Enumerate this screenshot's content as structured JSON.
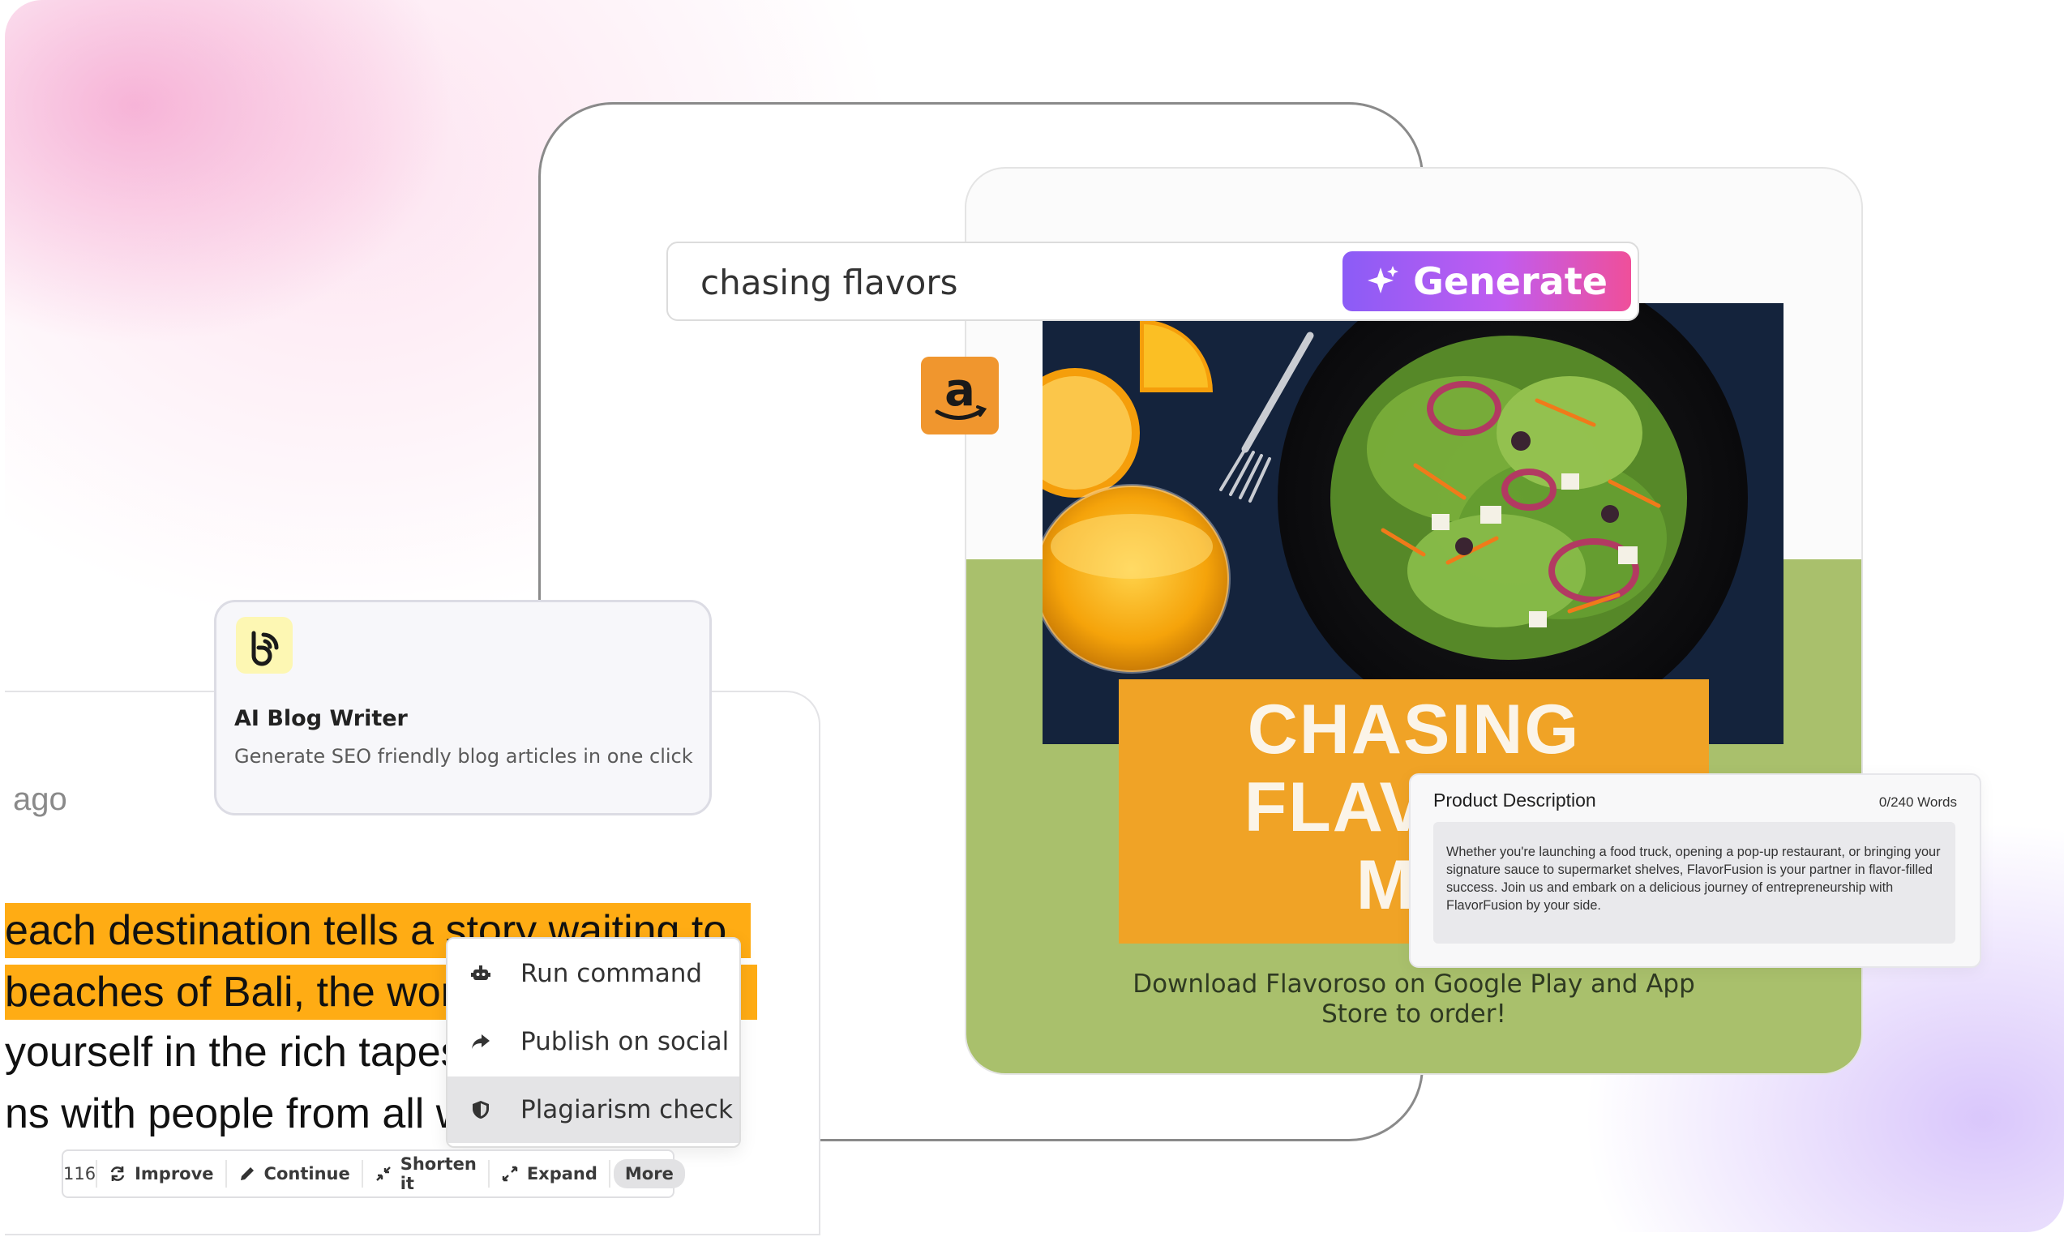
{
  "search": {
    "value": "chasing flavors",
    "generate_label": "Generate"
  },
  "poster": {
    "banner_lines": [
      "CHASING",
      "FLAVORS",
      "MO"
    ],
    "download_text": "Download Flavoroso on Google Play and App Store to order!"
  },
  "product_description": {
    "title": "Product Description",
    "word_count": "0/240 Words",
    "text": "Whether you're launching a food truck, opening a pop-up restaurant, or bringing your signature sauce to supermarket shelves, FlavorFusion is your partner in flavor-filled success. Join us and embark on a delicious journey of entrepreneurship with FlavorFusion by your side."
  },
  "blog_writer": {
    "title": "AI Blog Writer",
    "subtitle": "Generate SEO friendly blog articles in one click"
  },
  "editor": {
    "timestamp_fragment": "ago",
    "lines": [
      "each destination tells a story waiting to",
      "beaches of Bali, the wor",
      "yourself in the rich tapes",
      "ns with people from all w"
    ]
  },
  "context_menu": {
    "items": [
      {
        "label": "Run command",
        "icon": "robot-icon"
      },
      {
        "label": "Publish on social",
        "icon": "share-arrow-icon"
      },
      {
        "label": "Plagiarism check",
        "icon": "shield-icon"
      }
    ]
  },
  "toolbar": {
    "count": "116",
    "improve": "Improve",
    "continue": "Continue",
    "shorten": "Shorten it",
    "expand": "Expand",
    "more": "More"
  },
  "colors": {
    "accent_gradient_start": "#8b5cf6",
    "accent_gradient_end": "#ef4f9a",
    "highlight": "#ffac14",
    "poster_green": "#a9c06c",
    "banner_orange": "#f0a326",
    "amazon_orange": "#f0962e"
  }
}
